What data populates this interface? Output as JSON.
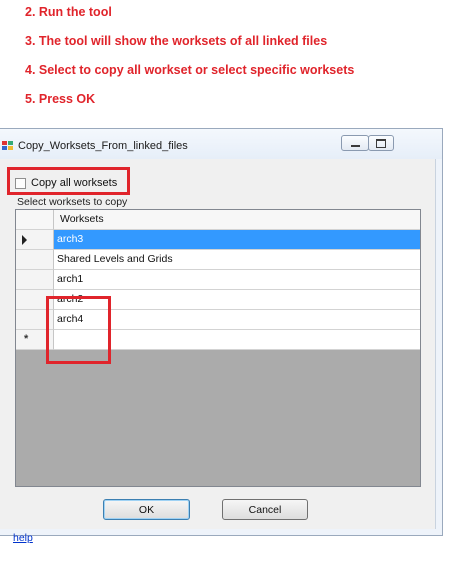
{
  "instructions": [
    "2. Run the tool",
    "3. The tool will show the worksets of all linked files",
    "4. Select to copy all workset or select specific worksets",
    "5. Press OK"
  ],
  "window": {
    "title": "Copy_Worksets_From_linked_files",
    "controls": [
      "minimize",
      "maximize"
    ]
  },
  "form": {
    "copy_all_label": "Copy all worksets",
    "copy_all_checked": false,
    "group_label": "Select worksets to copy",
    "grid": {
      "header": "Worksets",
      "rows": [
        "arch3",
        "Shared Levels and Grids",
        "arch1",
        "arch2",
        "arch4"
      ],
      "selected_index": 0,
      "new_row_marker": "*"
    },
    "ok_label": "OK",
    "cancel_label": "Cancel",
    "help_label": "help"
  },
  "colors": {
    "instruction_red": "#e0242b",
    "selection_blue": "#3399ff",
    "grid_empty": "#ababab",
    "link": "#0033cc"
  }
}
